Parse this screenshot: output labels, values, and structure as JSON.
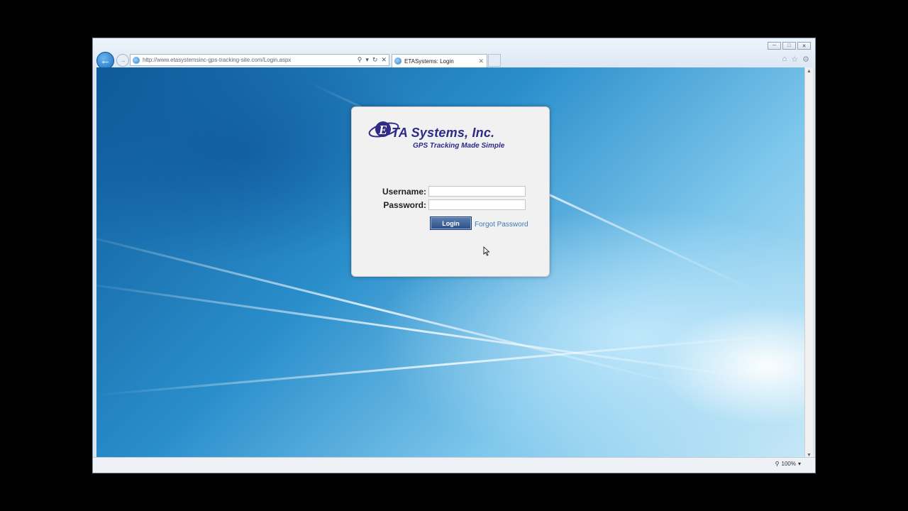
{
  "browser": {
    "url": "http://www.etasystemsinc-gps-tracking-site.com/Login.aspx",
    "tab_title": "ETASystems: Login",
    "zoom": "100%"
  },
  "login": {
    "brand_name": "TA Systems, Inc.",
    "brand_letter": "E",
    "tagline": "GPS Tracking Made Simple",
    "username_label": "Username:",
    "password_label": "Password:",
    "username_value": "",
    "password_value": "",
    "login_button": "Login",
    "forgot_link": "Forgot Password"
  },
  "colors": {
    "brand": "#2f2a86",
    "link": "#3c79b6",
    "button": "#2b4f86"
  }
}
